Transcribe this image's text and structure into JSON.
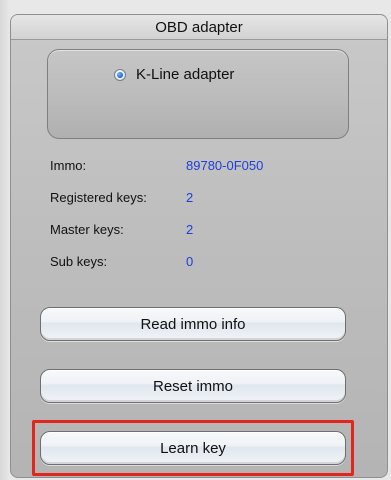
{
  "panel": {
    "title": "OBD adapter",
    "adapter_options": [
      {
        "label": "K-Line adapter",
        "selected": true
      }
    ]
  },
  "info": [
    {
      "label": "Immo:",
      "value": "89780-0F050"
    },
    {
      "label": "Registered keys:",
      "value": "2"
    },
    {
      "label": "Master keys:",
      "value": "2"
    },
    {
      "label": "Sub keys:",
      "value": "0"
    }
  ],
  "buttons": {
    "read": "Read immo info",
    "reset": "Reset immo",
    "learn": "Learn key"
  },
  "colors": {
    "value_text": "#1e3fd8",
    "highlight": "#e1261c"
  }
}
